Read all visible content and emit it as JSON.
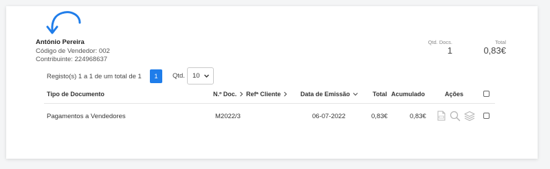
{
  "vendor": {
    "name": "António Pereira",
    "code_line": "Código de Vendedor: 002",
    "nif_line": "Contribuinte: 224968637"
  },
  "summary": {
    "docs_label": "Qtd. Docs.",
    "docs_value": "1",
    "total_label": "Total",
    "total_value": "0,83€"
  },
  "pager": {
    "records_text": "Registo(s) 1 a 1 de um total de 1",
    "current_page": "1",
    "qtd_label": "Qtd.",
    "qtd_value": "10"
  },
  "table": {
    "headers": {
      "tipo": "Tipo de Documento",
      "num": "N.º Doc.",
      "ref": "Refª Cliente",
      "data": "Data de Emissão",
      "total": "Total",
      "acum": "Acumulado",
      "acoes": "Ações"
    },
    "rows": [
      {
        "tipo": "Pagamentos a Vendedores",
        "num": "M2022/3",
        "data": "06-07-2022",
        "total": "0,83€",
        "acum": "0,83€"
      }
    ]
  },
  "colors": {
    "accent": "#1f7dea",
    "arrow": "#1f7dea"
  }
}
